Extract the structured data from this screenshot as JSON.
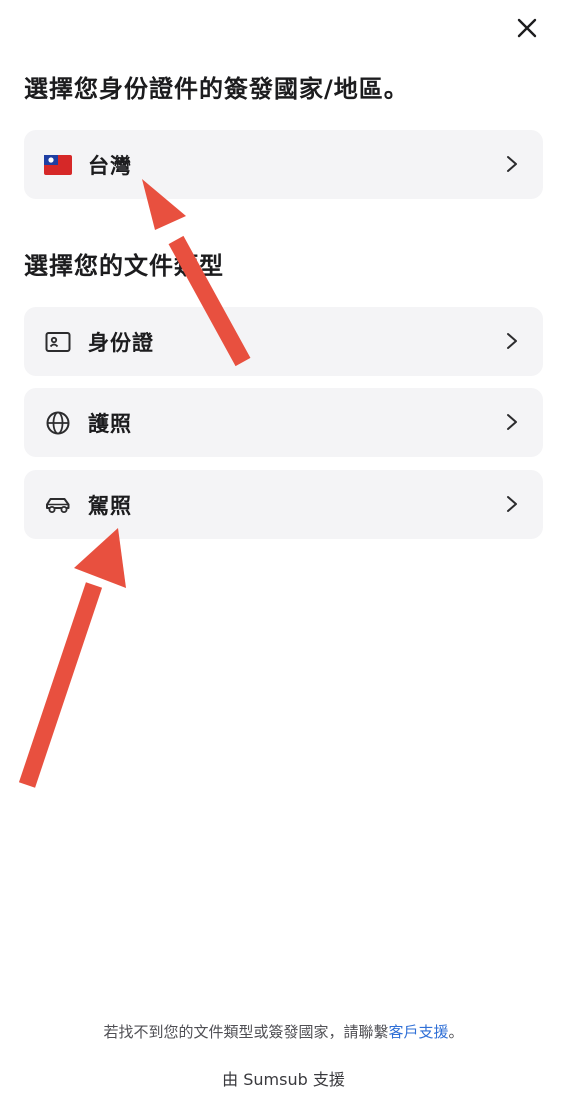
{
  "header": {
    "close_icon": "close-icon"
  },
  "country_section": {
    "heading": "選擇您身份證件的簽發國家/地區。",
    "selected_country": {
      "flag_icon": "taiwan-flag-icon",
      "label": "台灣",
      "chevron": "chevron-right-icon"
    }
  },
  "document_section": {
    "heading": "選擇您的文件類型",
    "options": [
      {
        "icon": "id-card-icon",
        "label": "身份證"
      },
      {
        "icon": "globe-icon",
        "label": "護照"
      },
      {
        "icon": "car-icon",
        "label": "駕照"
      }
    ]
  },
  "footer": {
    "note_prefix": "若找不到您的文件類型或簽發國家，請聯繫",
    "support_link": "客戶支援",
    "note_suffix": "。",
    "powered_by": "由 Sumsub 支援"
  },
  "colors": {
    "background": "#ffffff",
    "option_bg": "#f4f4f6",
    "link": "#2f6fd6",
    "arrow": "#e8503f"
  }
}
